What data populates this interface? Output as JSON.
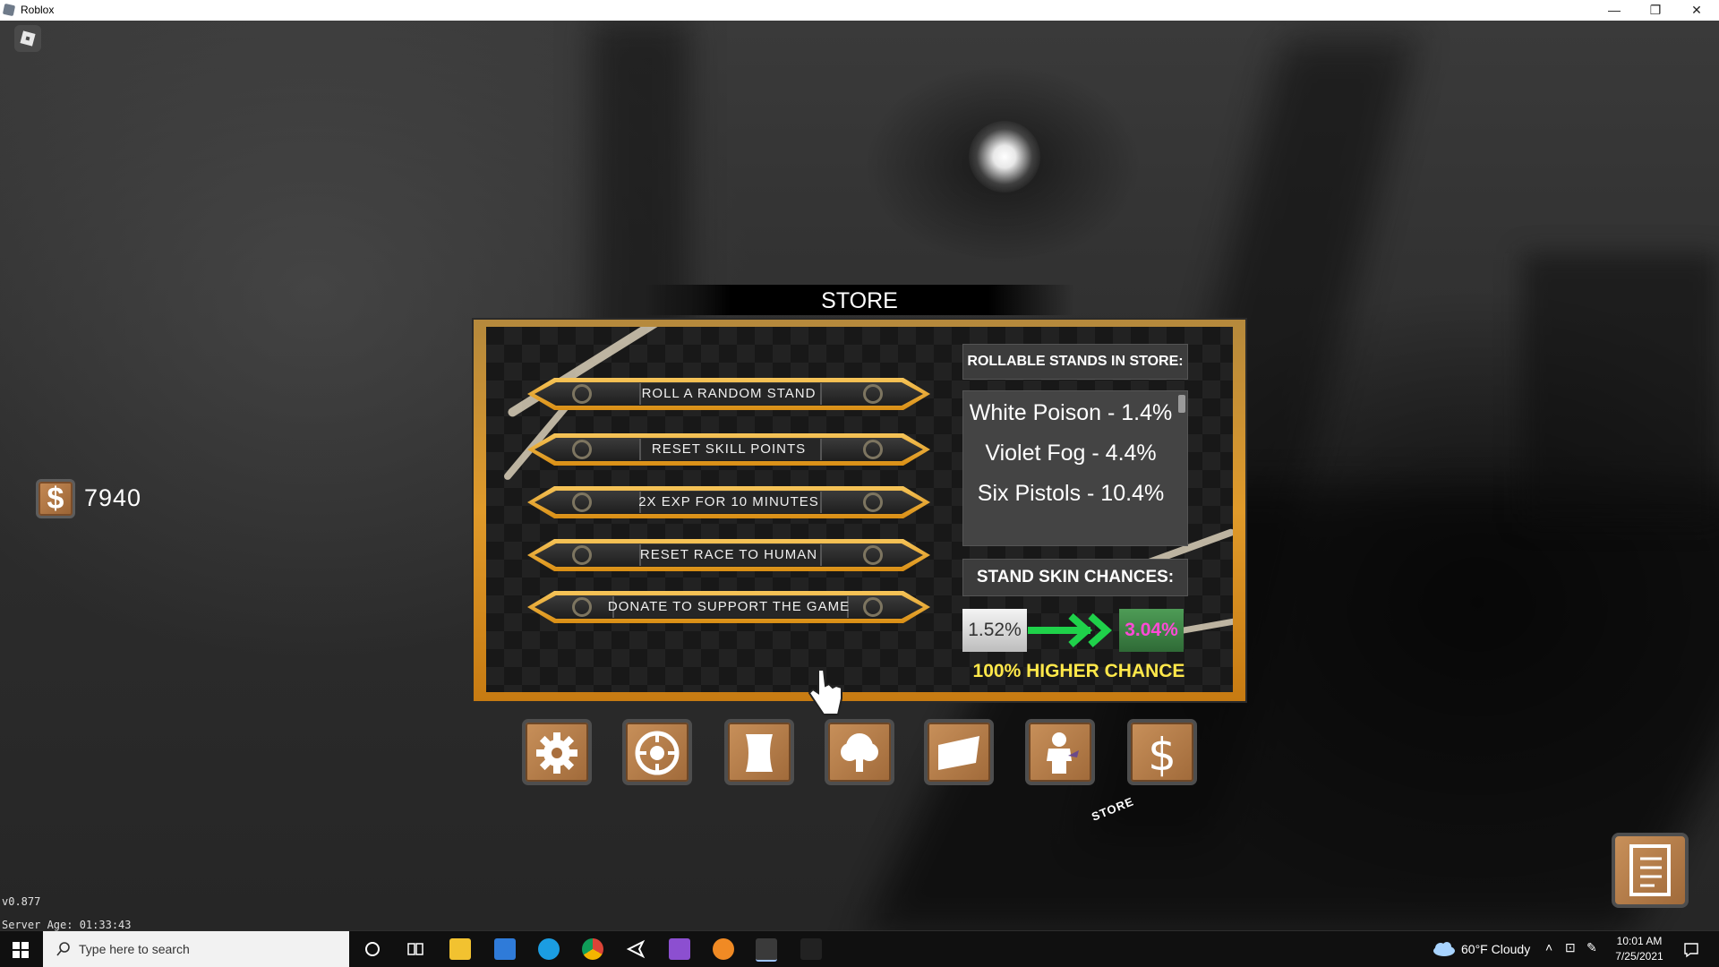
{
  "window": {
    "title": "Roblox",
    "minimize_glyph": "—",
    "restore_glyph": "❐",
    "close_glyph": "✕"
  },
  "hud": {
    "currency_symbol": "$",
    "currency_amount": "7940",
    "version": "v0.877",
    "server_age": "Server Age: 01:33:43",
    "store_hint": "STORE"
  },
  "store": {
    "title": "STORE",
    "options": [
      {
        "label": "ROLL A RANDOM STAND"
      },
      {
        "label": "RESET SKILL POINTS"
      },
      {
        "label": "2X EXP FOR 10 MINUTES"
      },
      {
        "label": "RESET RACE TO HUMAN"
      },
      {
        "label": "DONATE TO SUPPORT THE GAME"
      }
    ],
    "rollable_header": "ROLLABLE STANDS IN STORE:",
    "rollable_stands": [
      "White Poison - 1.4%",
      "Violet Fog - 4.4%",
      "Six Pistols - 10.4%"
    ],
    "skin_header": "STAND SKIN CHANCES:",
    "chance_before": "1.52%",
    "chance_after": "3.04%",
    "higher_text": "100% HIGHER CHANCE"
  },
  "hotbar": [
    {
      "icon": "gear-icon"
    },
    {
      "icon": "stats-wheel-icon"
    },
    {
      "icon": "scroll-icon"
    },
    {
      "icon": "tree-icon"
    },
    {
      "icon": "banner-icon"
    },
    {
      "icon": "character-icon"
    },
    {
      "icon": "dollar-icon"
    }
  ],
  "taskbar": {
    "search_placeholder": "Type here to search",
    "weather": "60°F  Cloudy",
    "time": "10:01 AM",
    "date": "7/25/2021"
  },
  "colors": {
    "frame_gold": "#e09a2a",
    "button_gold": "#f6c55a",
    "wood": "#b47a46",
    "higher_yellow": "#ffe84a",
    "arrow_green": "#1fd14a"
  }
}
